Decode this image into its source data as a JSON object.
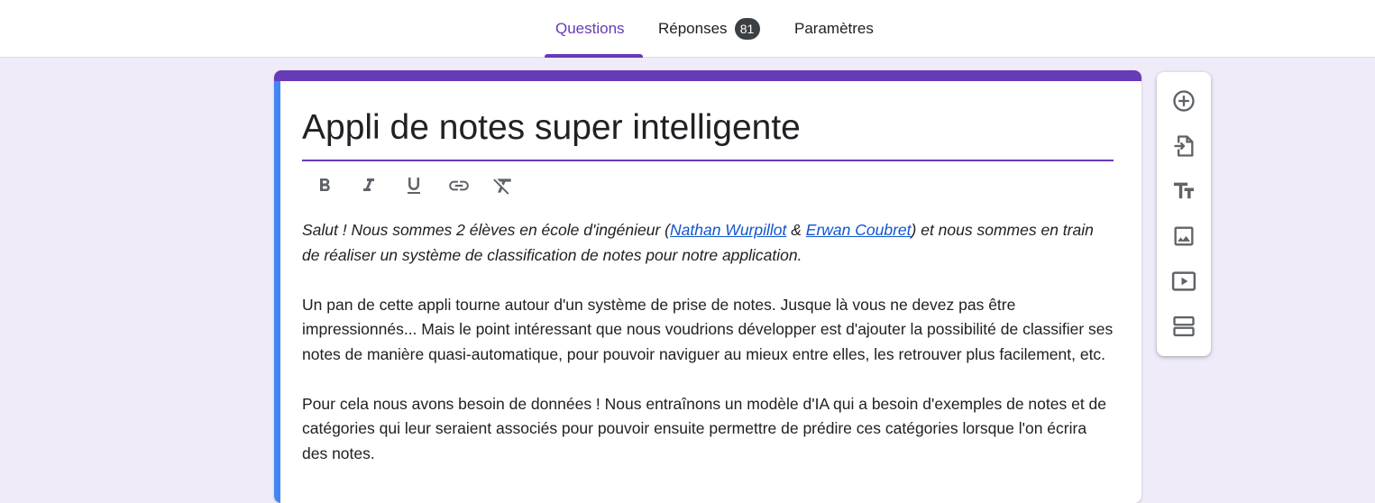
{
  "tabs": {
    "questions": "Questions",
    "responses": "Réponses",
    "responses_count": "81",
    "settings": "Paramètres"
  },
  "form": {
    "title": "Appli de notes super intelligente",
    "description": {
      "intro_before": "Salut ! Nous sommes 2 élèves en école d'ingénieur (",
      "author1": "Nathan Wurpillot",
      "amp": " & ",
      "author2": "Erwan Coubret",
      "intro_after": ") et nous sommes en train de réaliser un système de classification de notes pour notre application.",
      "paragraph2": "Un pan de cette appli tourne autour d'un système de prise de notes. Jusque là vous ne devez pas être impressionnés... Mais le point intéressant que nous voudrions développer est d'ajouter la possibilité de classifier ses notes de manière quasi-automatique, pour pouvoir naviguer au mieux entre elles, les retrouver plus facilement, etc.",
      "paragraph3": "Pour cela nous avons besoin de données ! Nous entraînons un modèle d'IA qui a besoin d'exemples de notes et de catégories qui leur seraient associés pour pouvoir ensuite permettre de prédire ces catégories lorsque l'on écrira des notes."
    }
  },
  "toolbar": {
    "icons": [
      "bold-icon",
      "italic-icon",
      "underline-icon",
      "link-icon",
      "clear-format-icon"
    ]
  },
  "sidebar": {
    "icons": [
      "add-question-icon",
      "import-questions-icon",
      "add-title-icon",
      "add-image-icon",
      "add-video-icon",
      "add-section-icon"
    ]
  },
  "colors": {
    "accent": "#673ab7",
    "background": "#f0ebf8",
    "focus_band": "#4285f4",
    "link": "#1155cc"
  }
}
